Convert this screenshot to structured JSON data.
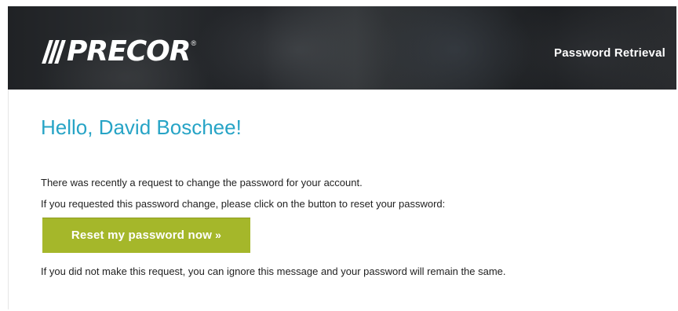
{
  "header": {
    "logo_text": "PRECOR",
    "logo_mark": "®",
    "title": "Password Retrieval"
  },
  "email": {
    "greeting": "Hello, David Boschee!",
    "line1": "There was recently a request to change the password for your account.",
    "line2": "If you requested this password change, please click on the button to reset your password:",
    "button_label": "Reset my password now",
    "button_suffix": "»",
    "line3": "If you did not make this request, you can ignore this message and your password will remain the same."
  },
  "colors": {
    "header_bg": "#26292c",
    "greeting": "#27a4c6",
    "button_bg": "#a5b72a",
    "button_text": "#ffffff",
    "body_text": "#222222"
  },
  "icons": {
    "logo": "precor-logo-stripes"
  }
}
